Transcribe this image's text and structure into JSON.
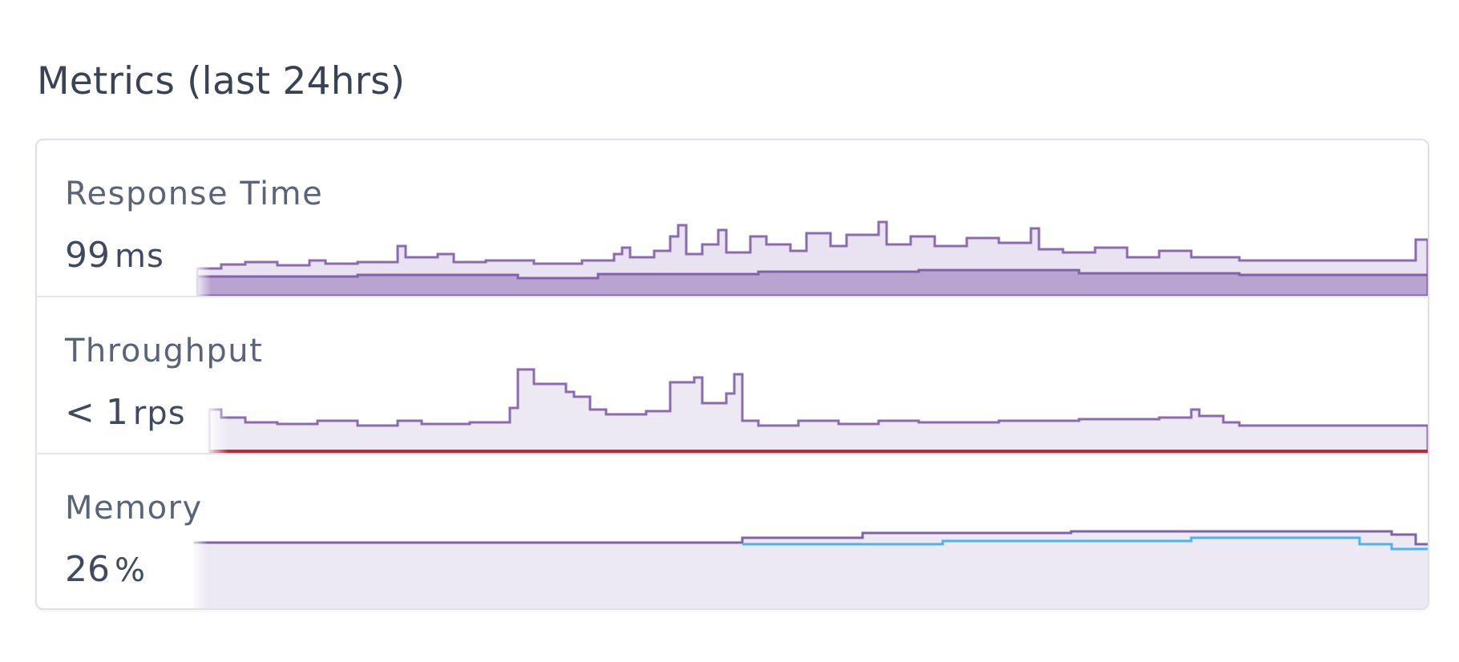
{
  "header": {
    "title": "Metrics (last 24hrs)"
  },
  "metrics": [
    {
      "label": "Response Time",
      "value": "99",
      "unit": "ms",
      "color": "#8a6bb0"
    },
    {
      "label": "Throughput",
      "value": "< 1",
      "unit": "rps",
      "color": "#8a6bb0",
      "error_color": "#c0283a"
    },
    {
      "label": "Memory",
      "value": "26",
      "unit": "%",
      "color": "#7f63a8",
      "secondary_color": "#4db3f0"
    }
  ]
}
